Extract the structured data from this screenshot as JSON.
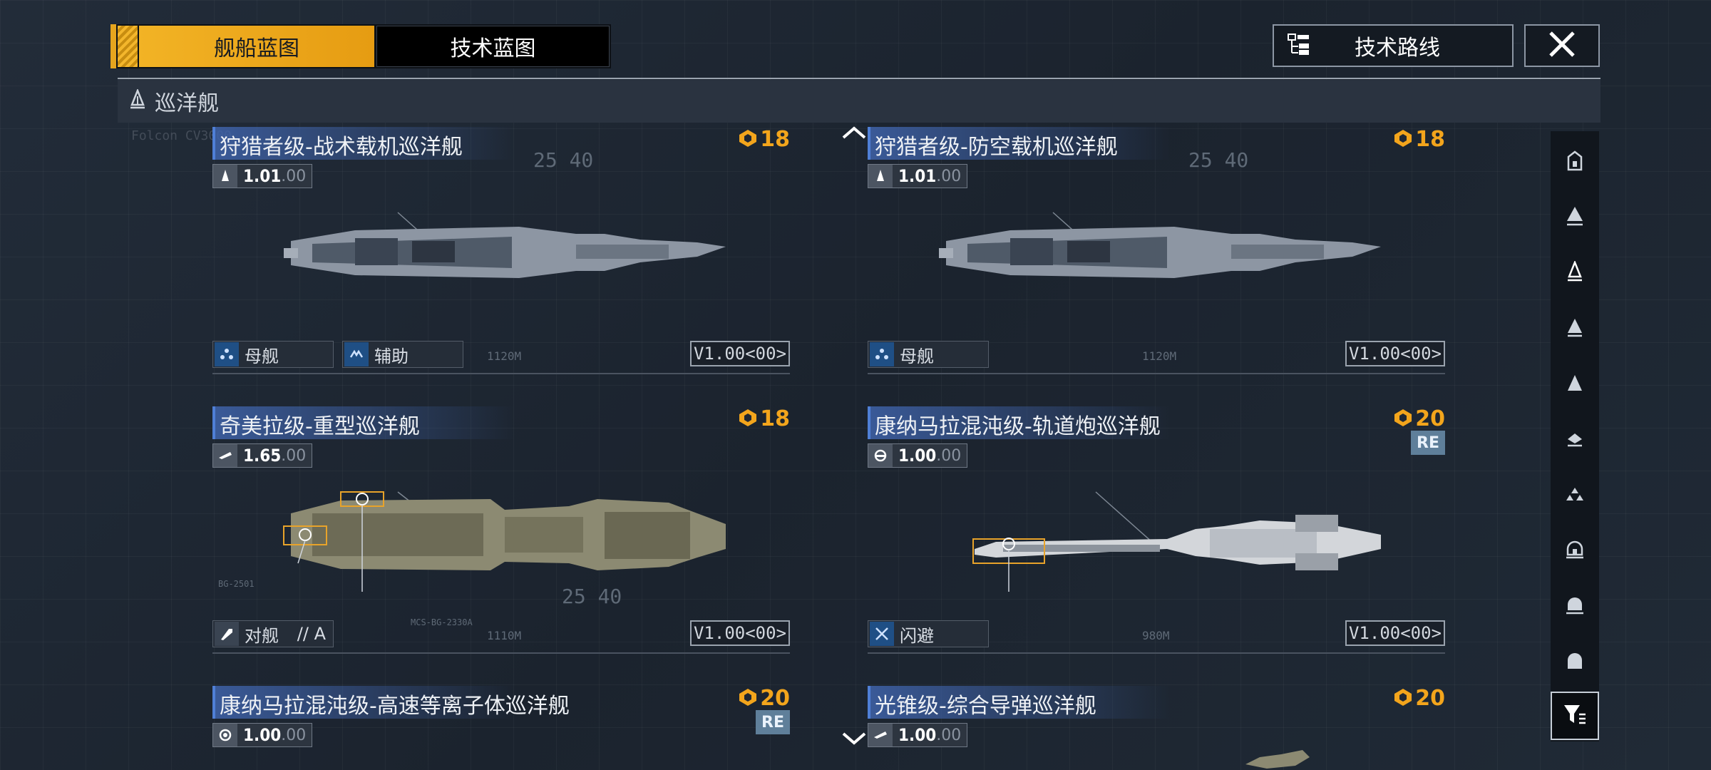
{
  "tabs": [
    {
      "label": "舰船蓝图",
      "active": true
    },
    {
      "label": "技术蓝图",
      "active": false
    }
  ],
  "tech_route": {
    "label": "技术路线"
  },
  "section": {
    "label": "巡洋舰"
  },
  "accent_color": "#f2b325",
  "cards": [
    {
      "title": "狩猎者级-战术载机巡洋舰",
      "cost": "18",
      "stat_main": "1.01",
      "stat_dec": ".00",
      "roles": [
        {
          "label": "母舰",
          "icon": "carrier-icon"
        },
        {
          "label": "辅助",
          "icon": "support-icon"
        }
      ],
      "version": "V1.00<00>",
      "length": "1120M"
    },
    {
      "title": "狩猎者级-防空载机巡洋舰",
      "cost": "18",
      "stat_main": "1.01",
      "stat_dec": ".00",
      "roles": [
        {
          "label": "母舰",
          "icon": "carrier-icon"
        }
      ],
      "version": "V1.00<00>",
      "length": "1120M"
    },
    {
      "title": "奇美拉级-重型巡洋舰",
      "cost": "18",
      "stat_main": "1.65",
      "stat_dec": ".00",
      "roles": [
        {
          "label": "对舰",
          "extra": "// A",
          "icon": "anti-ship-icon"
        }
      ],
      "version": "V1.00<00>",
      "length": "1110M",
      "weapon_labels": [
        "BG-2501",
        "MCS-BG-2330A"
      ]
    },
    {
      "title": "康纳马拉混沌级-轨道炮巡洋舰",
      "cost": "20",
      "badge": "RE",
      "stat_main": "1.00",
      "stat_dec": ".00",
      "roles": [
        {
          "label": "闪避",
          "icon": "evasion-icon"
        }
      ],
      "version": "V1.00<00>",
      "length": "980M"
    },
    {
      "title": "康纳马拉混沌级-高速等离子体巡洋舰",
      "cost": "20",
      "badge": "RE",
      "stat_main": "1.00",
      "stat_dec": ".00"
    },
    {
      "title": "光锥级-综合导弹巡洋舰",
      "cost": "20",
      "stat_main": "1.00",
      "stat_dec": ".00"
    }
  ],
  "rail_icons": [
    "class-icon-1",
    "class-icon-2",
    "class-icon-3",
    "class-icon-4",
    "class-icon-5",
    "class-icon-6",
    "class-icon-7",
    "class-icon-8",
    "class-icon-9",
    "class-icon-10"
  ]
}
